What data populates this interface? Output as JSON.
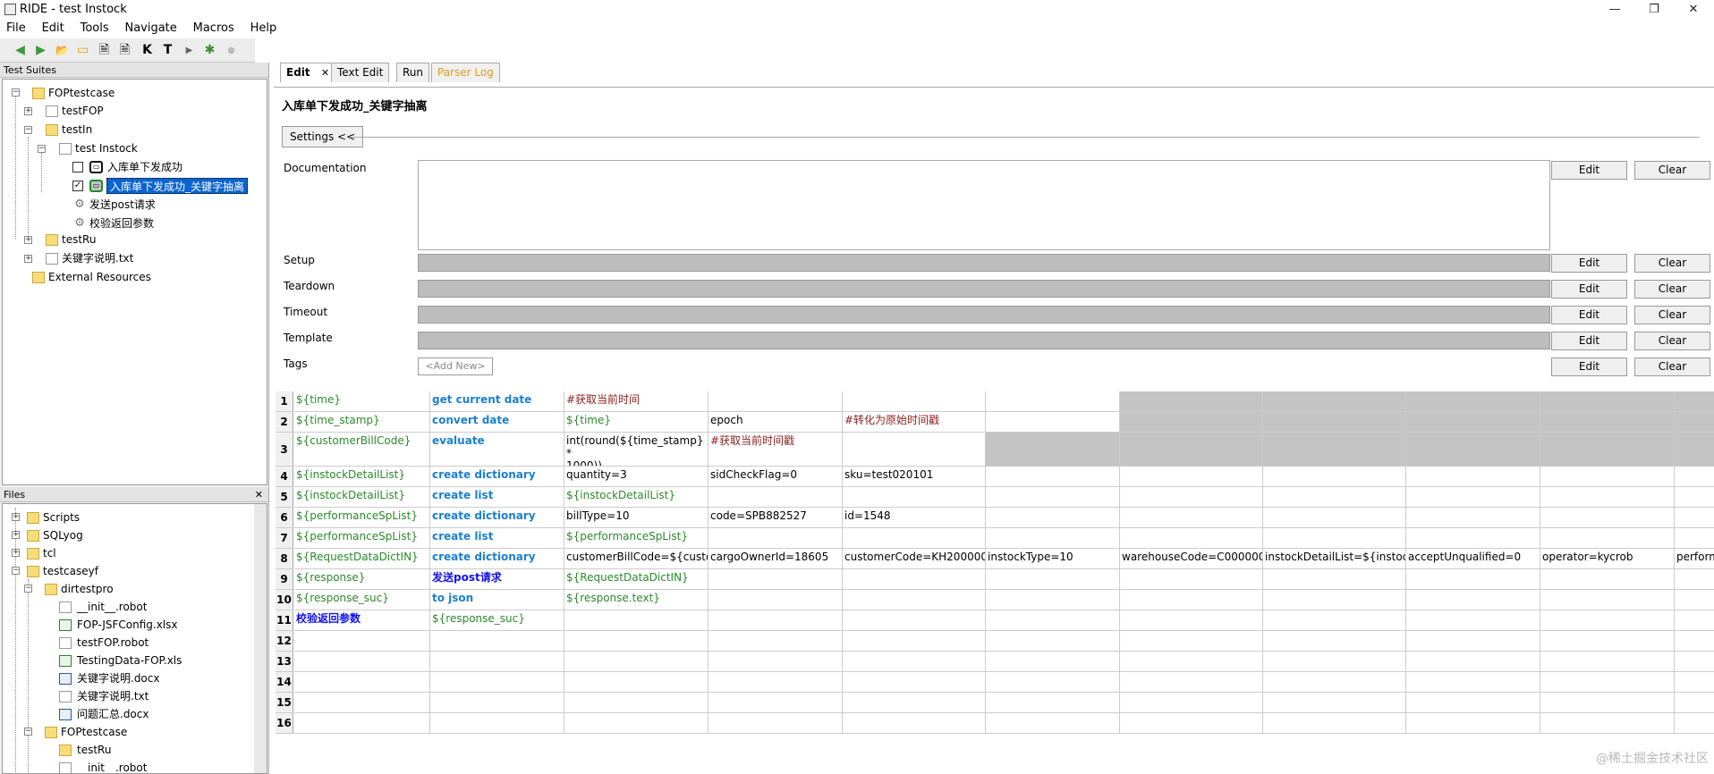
{
  "window": {
    "title": "RIDE - test Instock",
    "minimize": "—",
    "restore": "❐",
    "close": "✕"
  },
  "menu": [
    "File",
    "Edit",
    "Tools",
    "Navigate",
    "Macros",
    "Help"
  ],
  "toolbar": [
    "◀",
    "▶",
    "📂",
    "▭",
    "🗎",
    "🗎",
    "K",
    "T",
    "▶",
    "✱",
    "●"
  ],
  "test_suites": {
    "header": "Test Suites",
    "nodes": [
      "FOPtestcase",
      "testFOP",
      "testIn",
      "test Instock",
      "入库单下发成功",
      "入库单下发成功_关键字抽离",
      "发送post请求",
      "校验返回参数",
      "testRu",
      "关键字说明.txt",
      "External Resources"
    ]
  },
  "files": {
    "header": "Files",
    "close": "✕",
    "nodes": [
      "Scripts",
      "SQLyog",
      "tcl",
      "testcaseyf",
      "dirtestpro",
      "__init__.robot",
      "FOP-JSFConfig.xlsx",
      "testFOP.robot",
      "TestingData-FOP.xls",
      "关键字说明.docx",
      "关键字说明.txt",
      "问题汇总.docx",
      "FOPtestcase",
      "testRu",
      "__init__.robot"
    ]
  },
  "tabs": [
    {
      "label": "Edit",
      "close": "✕"
    },
    {
      "label": "Text Edit"
    },
    {
      "label": "Run"
    },
    {
      "label": "Parser Log",
      "color": "#e39a1a"
    }
  ],
  "editor": {
    "title": "入库单下发成功_关键字抽离",
    "settings_button": "Settings <<",
    "labels": {
      "documentation": "Documentation",
      "setup": "Setup",
      "teardown": "Teardown",
      "timeout": "Timeout",
      "template": "Template",
      "tags": "Tags"
    },
    "edit": "Edit",
    "clear": "Clear",
    "add_new": "<Add New>"
  },
  "grid": {
    "rows": [
      [
        "${time}",
        "get current date",
        "#获取当前时间",
        "",
        "",
        ""
      ],
      [
        "${time_stamp}",
        "convert date",
        "${time}",
        "epoch",
        "#转化为原始时间戳",
        ""
      ],
      [
        "${customerBillCode}",
        "evaluate",
        "int(round(${time_stamp} *|1000))",
        "#获取当前时间戳",
        "",
        ""
      ],
      [
        "${instockDetailList}",
        "create dictionary",
        "quantity=3",
        "sidCheckFlag=0",
        "sku=test020101",
        ""
      ],
      [
        "${instockDetailList}",
        "create list",
        "${instockDetailList}",
        "",
        "",
        ""
      ],
      [
        "${performanceSpList}",
        "create dictionary",
        "billType=10",
        "code=SPB882527",
        "id=1548",
        ""
      ],
      [
        "${performanceSpList}",
        "create list",
        "${performanceSpList}",
        "",
        "",
        ""
      ],
      [
        "${RequestDataDictIN}",
        "create dictionary",
        "customerBillCode=${custor",
        "cargoOwnerId=18605",
        "customerCode=KH2000000",
        "instockType=10",
        "warehouseCode=C0000000",
        "instockDetailList=${instock",
        "acceptUnqualified=0",
        "operator=kycrob",
        "perform"
      ],
      [
        "${response}",
        "发送post请求",
        "${RequestDataDictIN}",
        "",
        "",
        ""
      ],
      [
        "${response_suc}",
        "to json",
        "${response.text}",
        "",
        "",
        ""
      ],
      [
        "校验返回参数",
        "${response_suc}",
        "",
        "",
        "",
        ""
      ]
    ],
    "row_numbers": [
      "1",
      "2",
      "3",
      "4",
      "5",
      "6",
      "7",
      "8",
      "9",
      "10",
      "11",
      "12",
      "13",
      "14",
      "15",
      "16"
    ]
  },
  "watermark": "@稀土掘金技术社区"
}
